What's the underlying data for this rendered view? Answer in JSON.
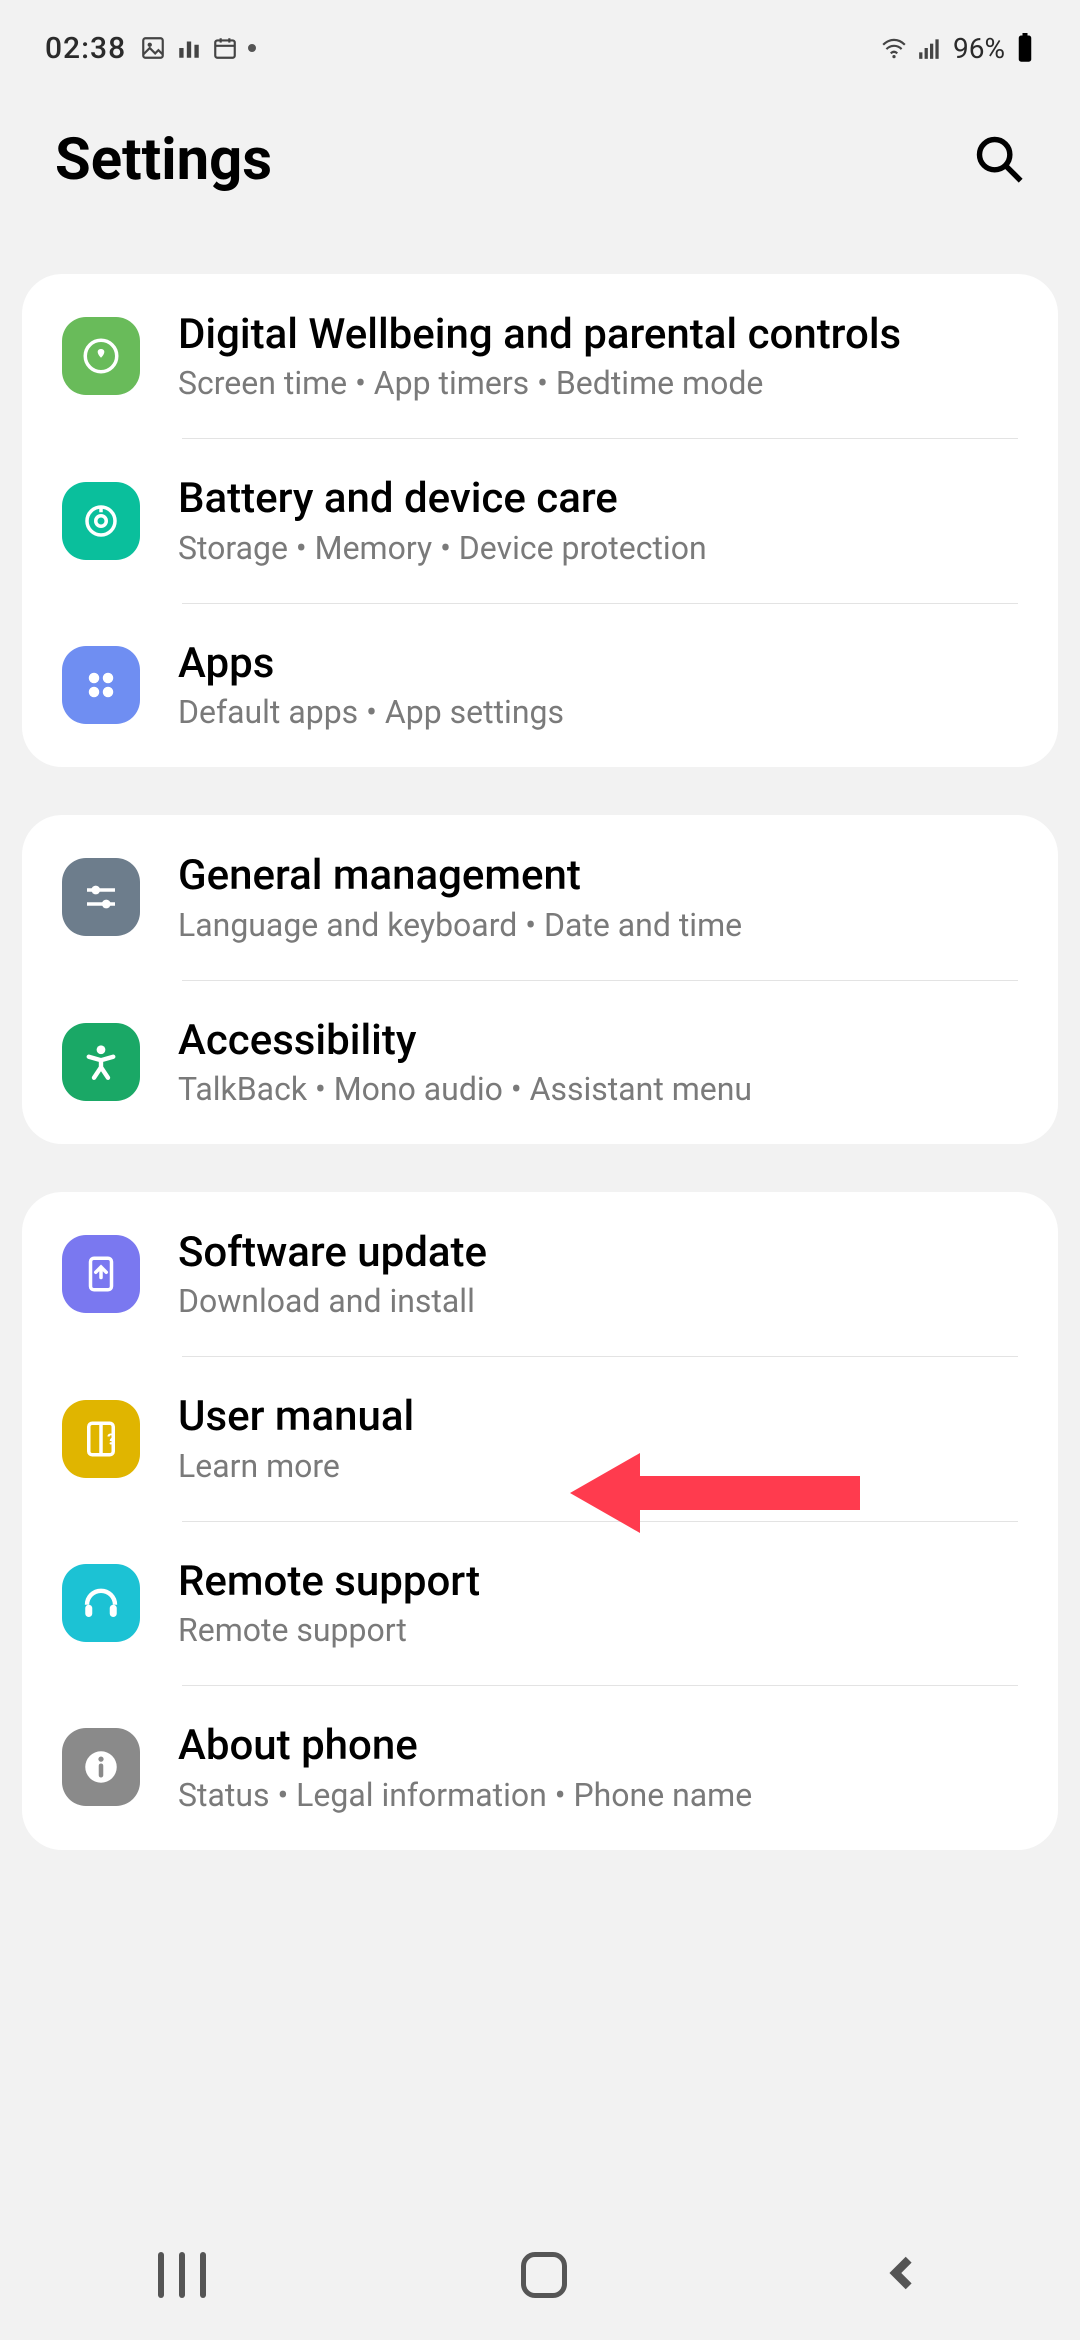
{
  "status": {
    "time": "02:38",
    "battery_pct": "96%"
  },
  "header": {
    "title": "Settings"
  },
  "sections": [
    [
      {
        "title": "Digital Wellbeing and parental controls",
        "subtitle": "Screen time  •  App timers  •  Bedtime mode",
        "icon": "wellbeing",
        "color": "#69bb5a"
      },
      {
        "title": "Battery and device care",
        "subtitle": "Storage  •  Memory  •  Device protection",
        "icon": "devicecare",
        "color": "#0abf9c"
      },
      {
        "title": "Apps",
        "subtitle": "Default apps  •  App settings",
        "icon": "apps",
        "color": "#6f8ef2"
      }
    ],
    [
      {
        "title": "General management",
        "subtitle": "Language and keyboard  •  Date and time",
        "icon": "general",
        "color": "#6d7d8c"
      },
      {
        "title": "Accessibility",
        "subtitle": "TalkBack  •  Mono audio  •  Assistant menu",
        "icon": "accessibility",
        "color": "#1aa866"
      }
    ],
    [
      {
        "title": "Software update",
        "subtitle": "Download and install",
        "icon": "update",
        "color": "#7a78f0"
      },
      {
        "title": "User manual",
        "subtitle": "Learn more",
        "icon": "manual",
        "color": "#e0b500"
      },
      {
        "title": "Remote support",
        "subtitle": "Remote support",
        "icon": "remote",
        "color": "#1cc2d4"
      },
      {
        "title": "About phone",
        "subtitle": "Status  •  Legal information  •  Phone name",
        "icon": "about",
        "color": "#8a8a8a"
      }
    ]
  ],
  "annotation": {
    "target_title": "Software update",
    "color": "#ff3b4e"
  }
}
